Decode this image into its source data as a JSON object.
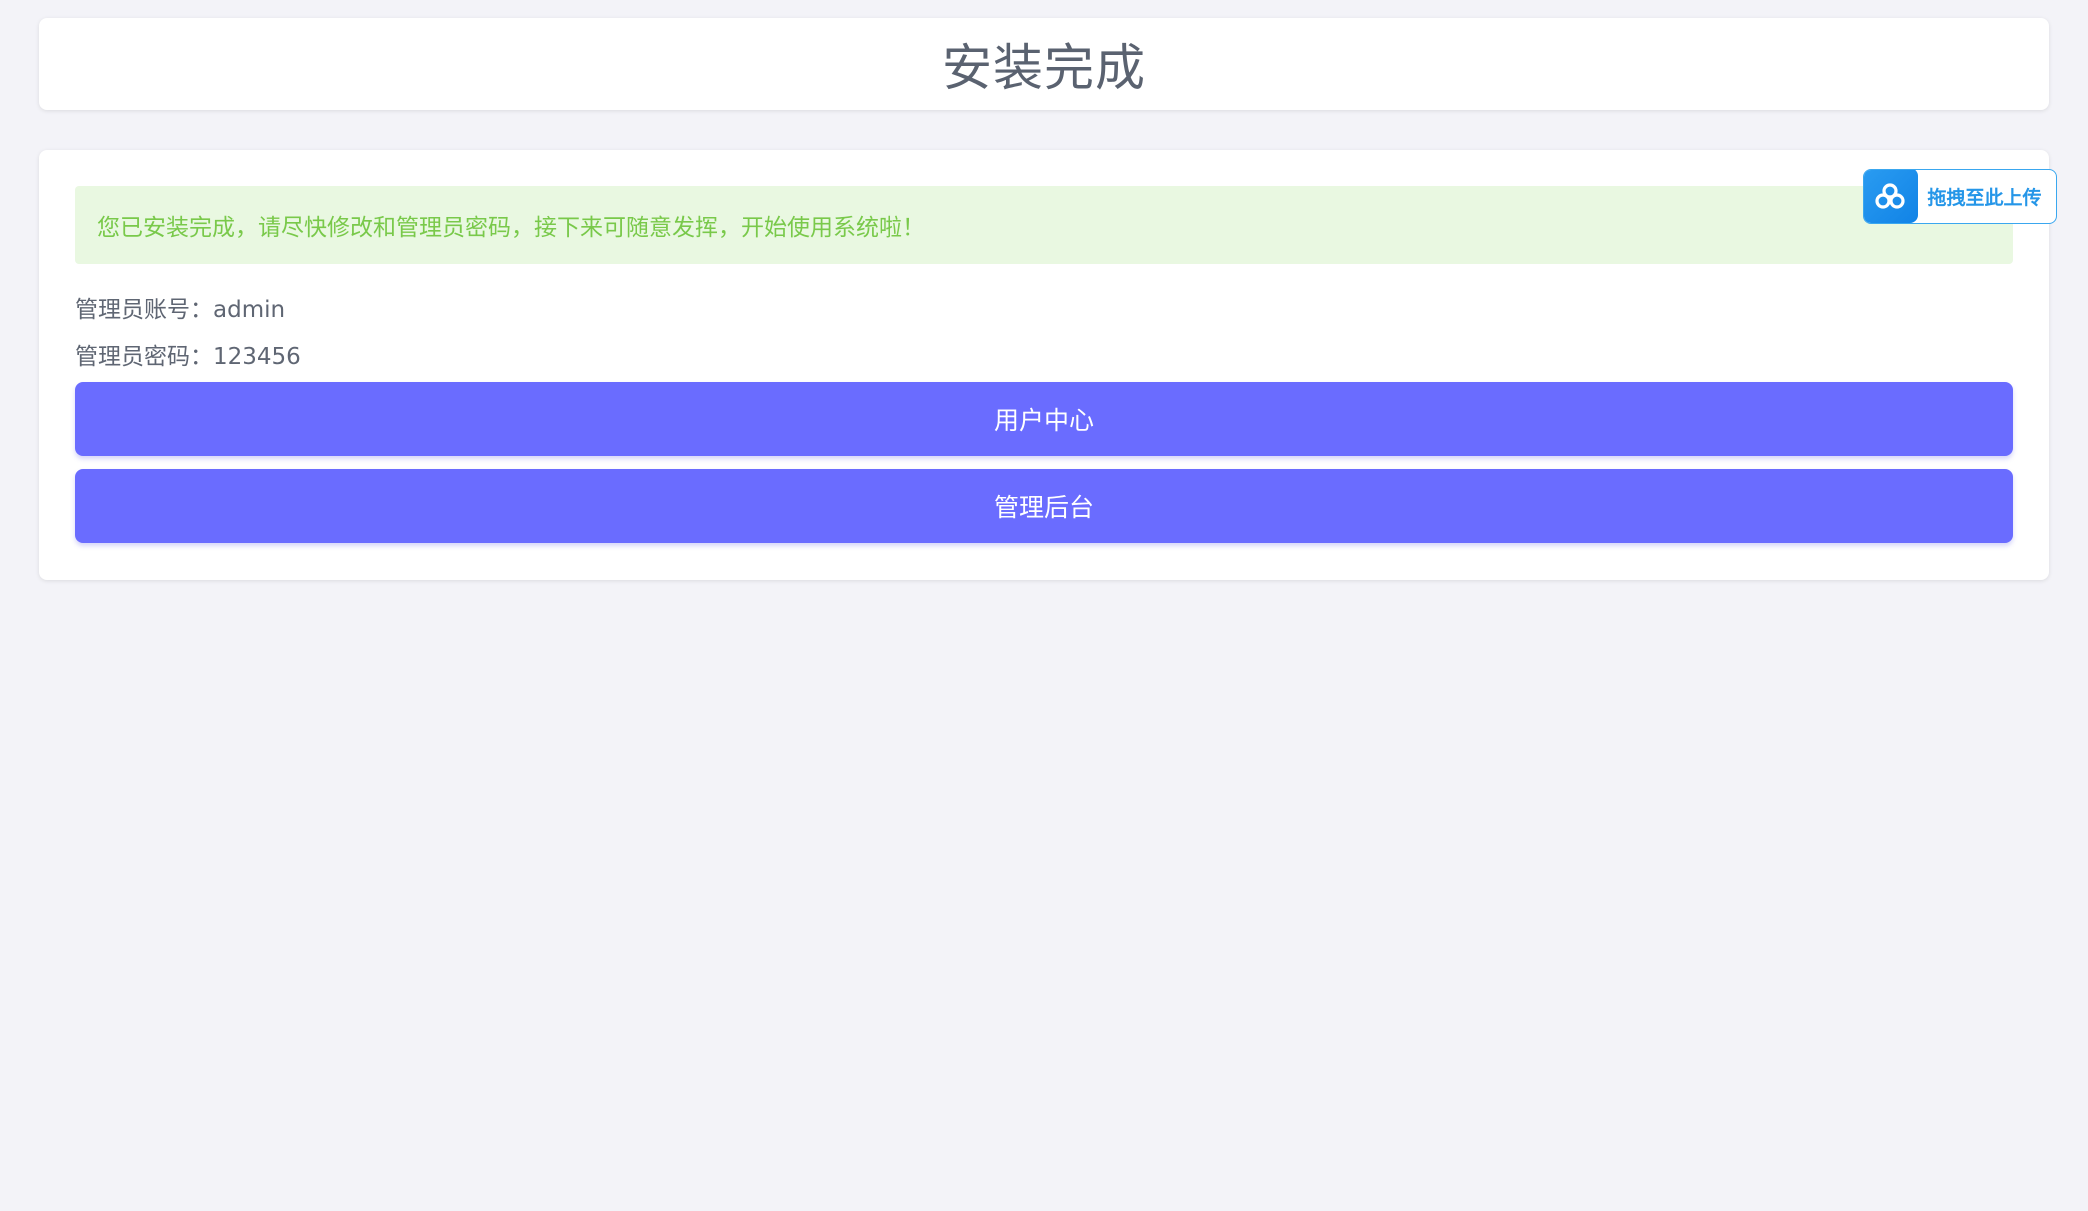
{
  "header": {
    "title": "安装完成"
  },
  "main": {
    "alert": {
      "text": "您已安装完成，请尽快修改和管理员密码，接下来可随意发挥，开始使用系统啦！",
      "color": "#79c94a",
      "background": "#e9f8e1"
    },
    "account_line": "管理员账号：admin",
    "password_line": "管理员密码：123456",
    "buttons": {
      "user_center": "用户中心",
      "admin_panel": "管理后台"
    },
    "button_color": "#6a6cff"
  },
  "upload_widget": {
    "label": "拖拽至此上传",
    "icon": "cloud-link-icon",
    "color": "#2596e8"
  }
}
